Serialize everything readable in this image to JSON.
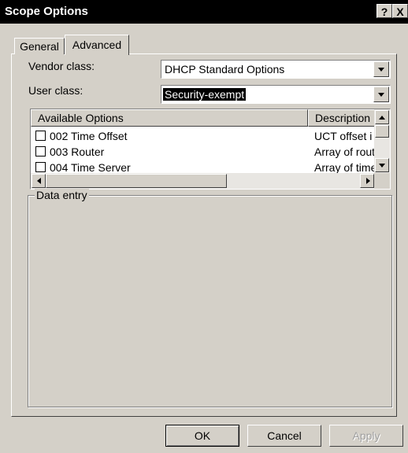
{
  "window": {
    "title": "Scope Options",
    "help_label": "?",
    "close_label": "X"
  },
  "tabs": [
    {
      "label": "General",
      "active": false
    },
    {
      "label": "Advanced",
      "active": true
    }
  ],
  "form": {
    "vendor_class_label": "Vendor class:",
    "vendor_class_value": "DHCP Standard Options",
    "user_class_label": "User class:",
    "user_class_value": "Security-exempt"
  },
  "options_list": {
    "columns": [
      "Available Options",
      "Description"
    ],
    "rows": [
      {
        "name": "002 Time Offset",
        "description": "UCT offset i",
        "checked": false
      },
      {
        "name": "003 Router",
        "description": "Array of rout",
        "checked": false
      },
      {
        "name": "004 Time Server",
        "description": "Array of time",
        "checked": false
      }
    ]
  },
  "data_entry": {
    "label": "Data entry"
  },
  "buttons": {
    "ok": "OK",
    "cancel": "Cancel",
    "apply": "Apply"
  },
  "icons": {
    "scroll_up": "arrow-up-icon",
    "scroll_down": "arrow-down-icon",
    "scroll_left": "arrow-left-icon",
    "scroll_right": "arrow-right-icon",
    "dropdown": "chevron-down-icon"
  }
}
